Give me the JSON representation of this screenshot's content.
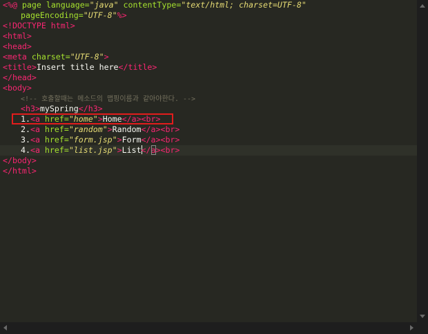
{
  "theme": {
    "background": "#272822",
    "tag": "#f92672",
    "attribute": "#a6e22e",
    "string": "#e6db74",
    "text": "#f8f8f2",
    "comment": "#75715e",
    "highlight_box": "#e31c1c"
  },
  "code": {
    "l1": {
      "open": "<%@",
      "page": " page",
      "attr_language": " language=",
      "val_language": "\"java\"",
      "attr_contenttype": " contentType=",
      "val_contenttype": "\"text/html; charset=UTF-8\""
    },
    "l2": {
      "attr_encoding": "pageEncoding=",
      "val_encoding": "\"UTF-8\"",
      "close": "%>"
    },
    "l3": {
      "doctype": "<!DOCTYPE html>"
    },
    "l4": {
      "html_open": "<html>"
    },
    "l5": {
      "head_open": "<head>"
    },
    "l6": {
      "meta_open": "<meta",
      "attr_charset": " charset=",
      "val_charset": "\"UTF-8\"",
      "meta_close": ">"
    },
    "l7": {
      "title_open": "<title>",
      "title_text": "Insert title here",
      "title_close": "</title>"
    },
    "l8": {
      "head_close": "</head>"
    },
    "l9": {
      "body_open": "<body>"
    },
    "l10": {
      "comment": "<!-- 호출할때는 메소드의 맵핑이름과 같아야한다. -->"
    },
    "l11": {
      "h3_open": "<h3>",
      "h3_text": "mySpring",
      "h3_close": "</h3>"
    },
    "links": [
      {
        "num": "1.",
        "a_open": "<a",
        "attr_href": " href=",
        "val_href": "\"home\"",
        "gt": ">",
        "text": "Home",
        "a_close": "</a>",
        "br": "<br>"
      },
      {
        "num": "2.",
        "a_open": "<a",
        "attr_href": " href=",
        "val_href": "\"random\"",
        "gt": ">",
        "text": "Random",
        "a_close": "</a>",
        "br": "<br>"
      },
      {
        "num": "3.",
        "a_open": "<a",
        "attr_href": " href=",
        "val_href": "\"form.jsp\"",
        "gt": ">",
        "text": "Form",
        "a_close": "</a>",
        "br": "<br>"
      },
      {
        "num": "4.",
        "a_open": "<a",
        "attr_href": " href=",
        "val_href": "\"list.jsp\"",
        "gt": ">",
        "text": "List",
        "a_close_lt": "</",
        "a_close_a": "a",
        "a_close_gt": ">",
        "br": "<br>"
      }
    ],
    "l16": {
      "body_close": "</body>"
    },
    "l17": {
      "html_close": "</html>"
    }
  }
}
